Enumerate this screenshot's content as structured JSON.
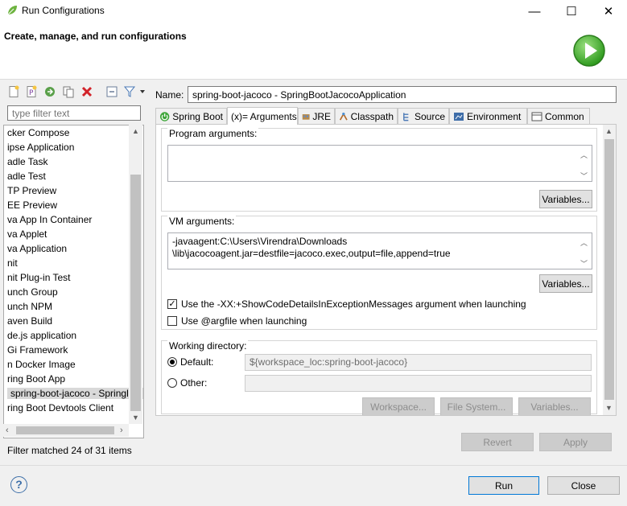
{
  "window": {
    "title": "Run Configurations",
    "controls": {
      "minimize": "—",
      "maximize": "☐",
      "close": "✕"
    }
  },
  "header": {
    "title": "Create, manage, and run configurations",
    "icon": "run-icon"
  },
  "toolbar": {
    "icons": [
      "new-config-icon",
      "new-prototype-icon",
      "export-icon",
      "duplicate-icon",
      "delete-icon",
      "collapse-all-icon",
      "filter-icon",
      "dropdown-icon"
    ]
  },
  "filter": {
    "placeholder": "type filter text",
    "status": "Filter matched 24 of 31 items"
  },
  "tree": {
    "items": [
      "cker Compose",
      "ipse Application",
      "adle Task",
      "adle Test",
      "TP Preview",
      "EE Preview",
      "va App In Container",
      "va Applet",
      "va Application",
      "nit",
      "nit Plug-in Test",
      "unch Group",
      "unch NPM",
      "aven Build",
      "de.js application",
      "Gi Framework",
      "n Docker Image",
      "ring Boot App",
      "spring-boot-jacoco - Springl",
      "ring Boot Devtools Client"
    ],
    "selected_index": 18
  },
  "name": {
    "label": "Name:",
    "value": "spring-boot-jacoco - SpringBootJacocoApplication"
  },
  "tabs": [
    {
      "label": "Spring Boot",
      "icon": "spring-boot-icon"
    },
    {
      "label": "(x)= Arguments",
      "icon": ""
    },
    {
      "label": "JRE",
      "icon": "jre-icon"
    },
    {
      "label": "Classpath",
      "icon": "classpath-icon"
    },
    {
      "label": "Source",
      "icon": "source-icon"
    },
    {
      "label": "Environment",
      "icon": "environment-icon"
    },
    {
      "label": "Common",
      "icon": "common-icon"
    }
  ],
  "active_tab": 1,
  "arguments": {
    "program": {
      "label": "Program arguments:",
      "value": "",
      "variables_button": "Variables..."
    },
    "vm": {
      "label": "VM arguments:",
      "line1": "-javaagent:C:\\Users\\Virendra\\Downloads",
      "line2": "\\lib\\jacocoagent.jar=destfile=jacoco.exec,output=file,append=true",
      "variables_button": "Variables..."
    },
    "show_code_details": {
      "label": "Use the -XX:+ShowCodeDetailsInExceptionMessages argument when launching",
      "checked": true
    },
    "argfile": {
      "label": "Use @argfile when launching",
      "checked": false
    },
    "working_directory": {
      "label": "Working directory:",
      "default_label": "Default:",
      "default_value": "${workspace_loc:spring-boot-jacoco}",
      "other_label": "Other:",
      "other_value": "",
      "selected": "default",
      "workspace_button": "Workspace...",
      "filesystem_button": "File System...",
      "variables_button": "Variables..."
    }
  },
  "actions": {
    "revert": "Revert",
    "apply": "Apply",
    "run": "Run",
    "close": "Close"
  },
  "colors": {
    "accent": "#0078d7",
    "run_green": "#3fae2a",
    "selection": "#d9d9d9"
  }
}
